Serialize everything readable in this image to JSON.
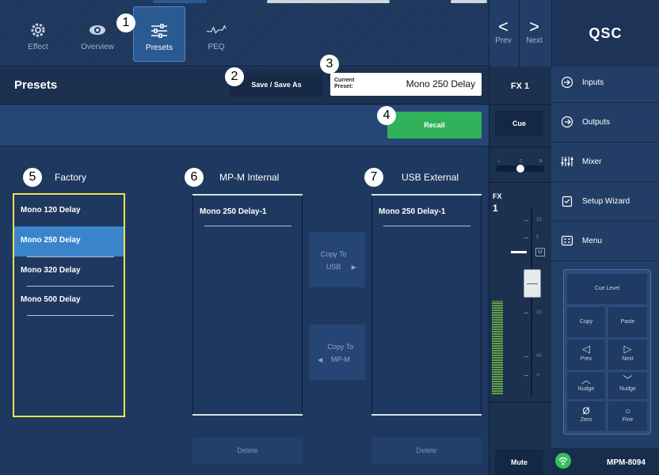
{
  "top_tabs": [
    {
      "label": "Effect",
      "icon": "gear-icon"
    },
    {
      "label": "Overview",
      "icon": "eye-icon"
    },
    {
      "label": "Presets",
      "icon": "sliders-icon"
    },
    {
      "label": "PEQ",
      "icon": "eq-curve-icon"
    }
  ],
  "nav": {
    "prev_label": "Prev",
    "next_label": "Next",
    "prev_arrow": "<",
    "next_arrow": ">"
  },
  "brand": {
    "logo": "QSC"
  },
  "presets": {
    "title": "Presets",
    "save_label": "Save / Save As",
    "current_label": "Current Preset:",
    "current_value": "Mono 250 Delay",
    "recall_label": "Recall"
  },
  "callouts": [
    "1",
    "2",
    "3",
    "4",
    "5",
    "6",
    "7"
  ],
  "columns": {
    "factory": {
      "title": "Factory",
      "items": [
        "Mono 120 Delay",
        "Mono 250 Delay",
        "Mono 320 Delay",
        "Mono 500 Delay"
      ],
      "selected_index": 1
    },
    "internal": {
      "title": "MP-M Internal",
      "items": [
        "Mono 250 Delay-1"
      ],
      "delete_label": "Delete"
    },
    "external": {
      "title": "USB External",
      "items": [
        "Mono 250 Delay-1"
      ],
      "delete_label": "Delete"
    }
  },
  "copy": {
    "to_usb": "Copy To USB",
    "to_mpm": "Copy To MP-M"
  },
  "strip": {
    "name": "FX 1",
    "cue_label": "Cue",
    "pan_labels": [
      "L",
      "C",
      "R"
    ],
    "meter_label": "FX",
    "meter_sub": "1",
    "unity_label": "U",
    "scale_labels": [
      "10",
      "5",
      "10",
      "20",
      "40",
      "∞"
    ],
    "mute_label": "Mute"
  },
  "menu": [
    {
      "label": "Inputs",
      "icon": "input-icon"
    },
    {
      "label": "Outputs",
      "icon": "output-icon"
    },
    {
      "label": "Mixer",
      "icon": "mixer-icon"
    },
    {
      "label": "Setup Wizard",
      "icon": "wizard-icon"
    },
    {
      "label": "Menu",
      "icon": "menu-icon"
    }
  ],
  "pad": {
    "cue_level": "Cue Level",
    "copy": "Copy",
    "paste": "Paste",
    "prev": "Prev",
    "next": "Next",
    "nudge_up": "Nudge",
    "nudge_down": "Nudge",
    "zero": "Zero",
    "fine": "Fine"
  },
  "status": {
    "model": "MPM-8094"
  },
  "colors": {
    "accent": "#3a84cc",
    "recall": "#2fb25a",
    "highlight": "#f0e050",
    "wifi": "#35c15d"
  }
}
